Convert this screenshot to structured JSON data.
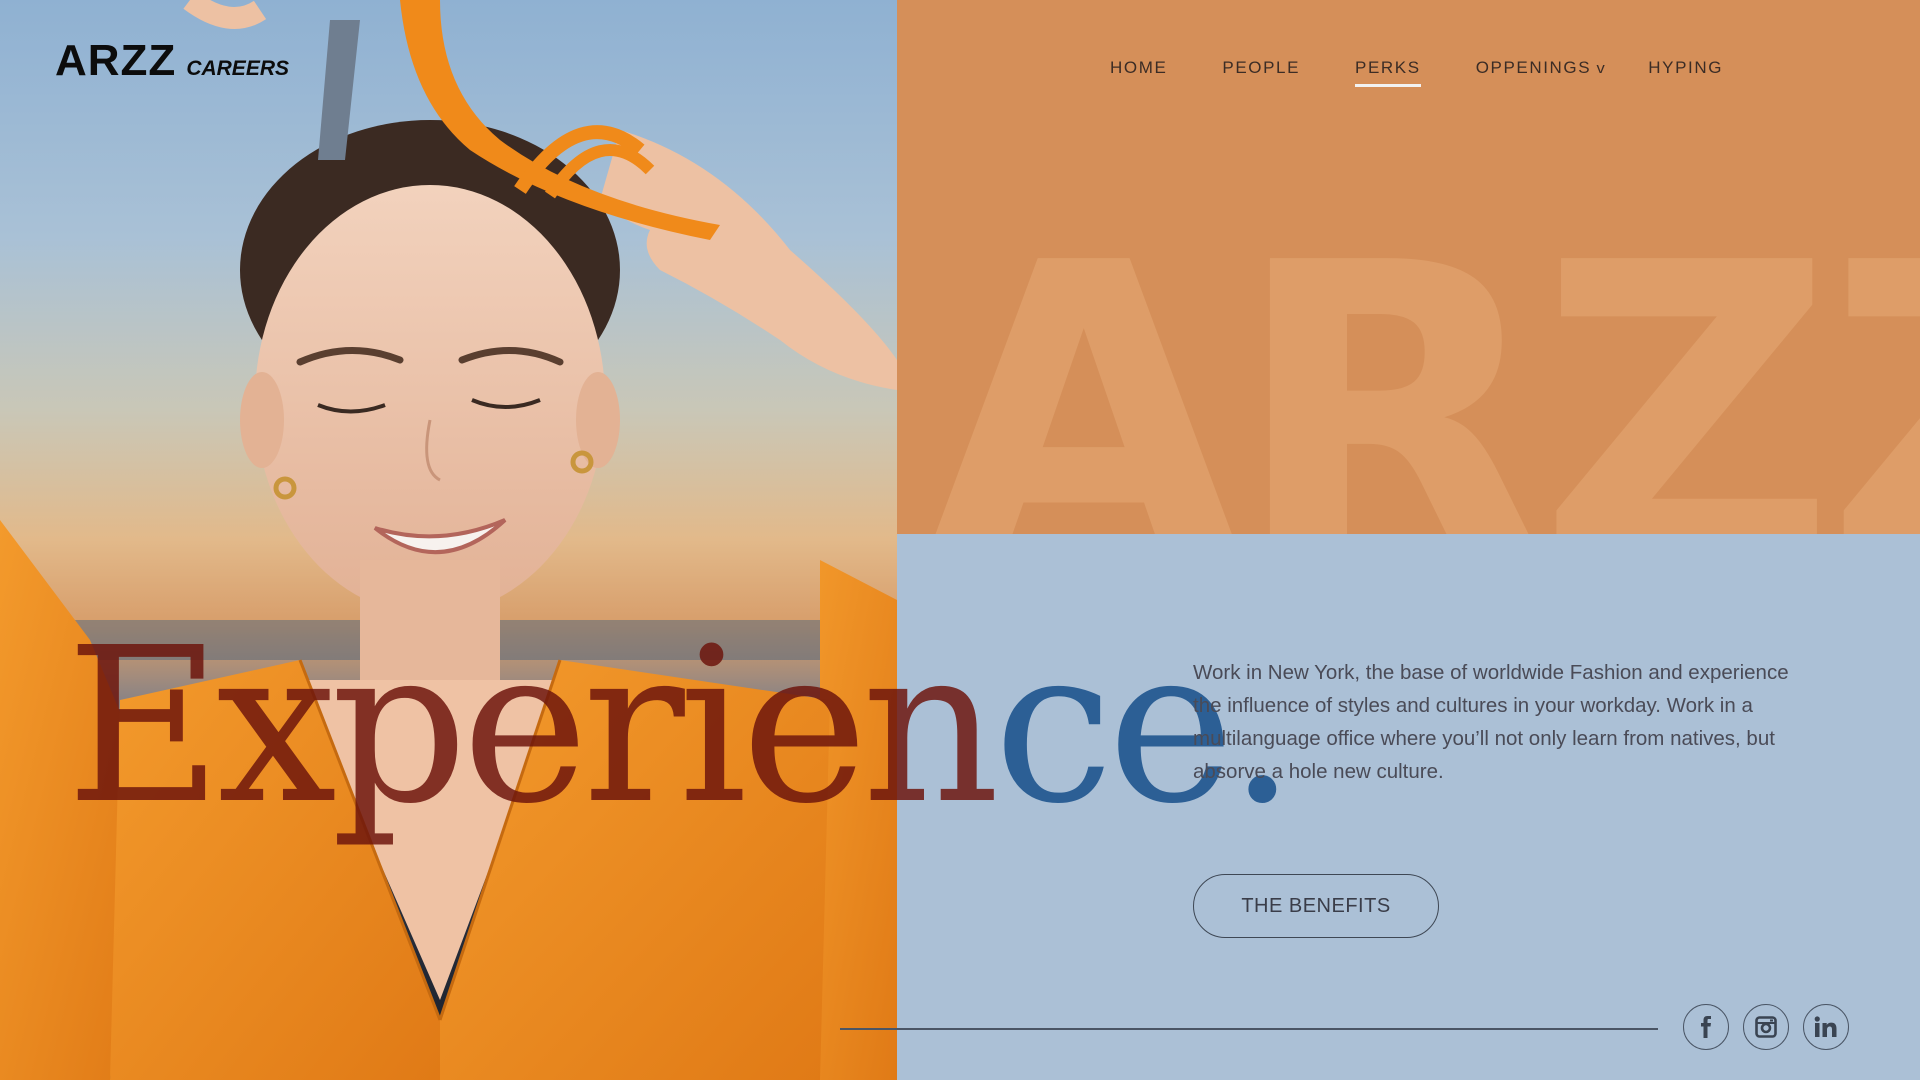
{
  "brand": {
    "logo_mark": "ARZZ",
    "logo_sub": "CAREERS",
    "watermark": "ARZZ"
  },
  "nav": {
    "items": [
      {
        "label": "HOME"
      },
      {
        "label": "PEOPLE"
      },
      {
        "label": "PERKS",
        "active": true
      },
      {
        "label": "OPPENINGS",
        "has_dropdown": true
      },
      {
        "label": "HYPING"
      }
    ],
    "dropdown_caret": "v"
  },
  "hero": {
    "headline_left": "Experien",
    "headline_right": "ce",
    "headline_dot": ".",
    "body": "Work in New York, the base of worldwide Fashion and experience the influence of styles and cultures in your workday. Work in a multilanguage office where you’ll not only learn from natives, but absorve a hole new culture.",
    "cta_label": "THE BENEFITS"
  },
  "socials": [
    {
      "icon": "facebook-icon"
    },
    {
      "icon": "instagram-icon"
    },
    {
      "icon": "linkedin-icon"
    }
  ],
  "colors": {
    "orange_panel": "#d58f59",
    "blue_panel": "#abc0d6",
    "headline_blue": "#2c5f95",
    "headline_overlay": "#6c140c"
  }
}
